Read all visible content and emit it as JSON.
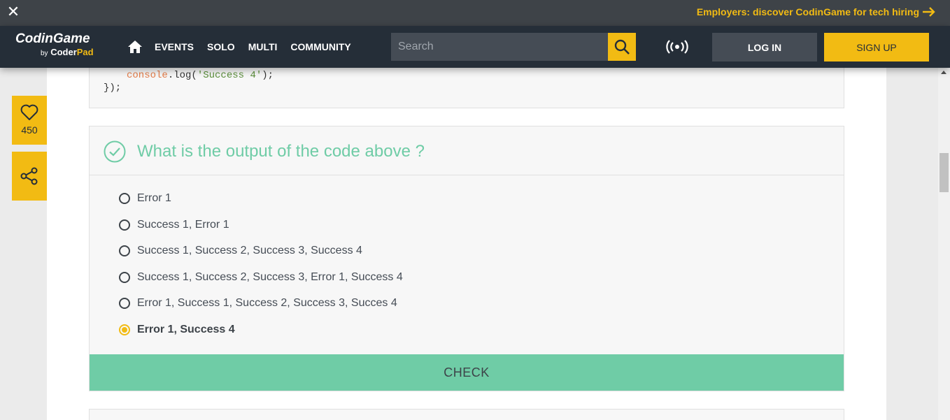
{
  "topbar": {
    "close_icon": "close-icon",
    "employers_text": "Employers: discover CodinGame for tech hiring",
    "arrow_icon": "arrow-right-icon"
  },
  "navbar": {
    "logo_main": "CodinGame",
    "logo_by": "by",
    "logo_coder": "Coder",
    "logo_pad": "Pad",
    "links": [
      "EVENTS",
      "SOLO",
      "MULTI",
      "COMMUNITY"
    ],
    "search_placeholder": "Search",
    "login_label": "LOG IN",
    "signup_label": "SIGN UP"
  },
  "sidebar": {
    "like_count": "450"
  },
  "code": {
    "line1_fn": "console",
    "line1_mid": ".log(",
    "line1_str": "'Success 4'",
    "line1_end": ");",
    "line2": "});"
  },
  "question": {
    "title": "What is the output of the code above ?",
    "options": [
      "Error 1",
      "Success 1, Error 1",
      "Success 1, Success 2, Success 3, Success 4",
      "Success 1, Success 2, Success 3, Error 1, Success 4",
      "Error 1, Success 1, Success 2, Success 3, Succes 4",
      "Error 1, Success 4"
    ],
    "selected_index": 5,
    "check_label": "CHECK"
  },
  "colors": {
    "accent_yellow": "#f2bb13",
    "nav_bg": "#252e38",
    "green": "#6fcca6"
  }
}
